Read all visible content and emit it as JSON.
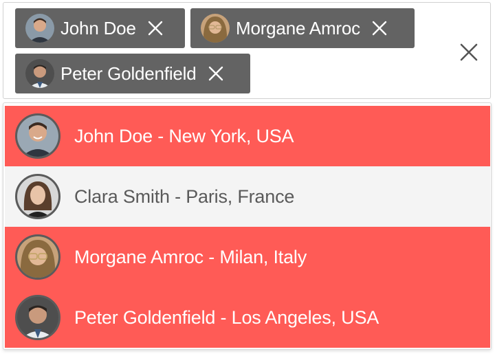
{
  "selected_chips": [
    {
      "label": "John Doe",
      "avatar_icon": "person-avatar-icon"
    },
    {
      "label": "Morgane Amroc",
      "avatar_icon": "person-avatar-icon"
    },
    {
      "label": "Peter Goldenfield",
      "avatar_icon": "person-avatar-icon"
    }
  ],
  "options": [
    {
      "label": "John Doe - New York, USA",
      "selected": true
    },
    {
      "label": "Clara Smith - Paris, France",
      "selected": false
    },
    {
      "label": "Morgane Amroc - Milan, Italy",
      "selected": true
    },
    {
      "label": "Peter Goldenfield - Los Angeles, USA",
      "selected": true
    }
  ],
  "icons": {
    "chip_remove": "close-icon",
    "clear_all": "close-icon"
  },
  "colors": {
    "chip_background": "#636363",
    "selected_option_background": "#ff5b56",
    "unselected_option_background": "#f4f4f4",
    "selected_option_text": "#ffffff",
    "unselected_option_text": "#5a5a5a"
  }
}
